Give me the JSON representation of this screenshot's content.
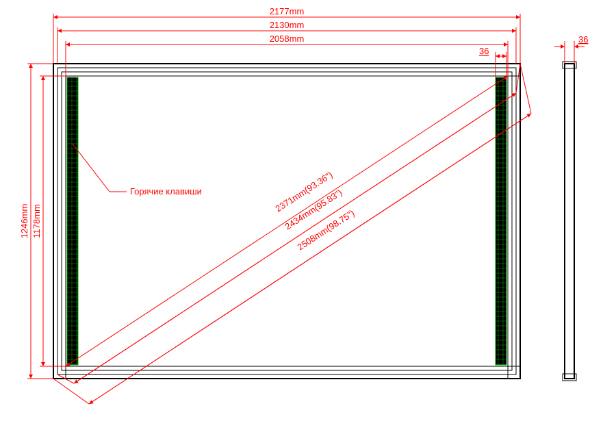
{
  "top_dims": {
    "d1": "2177mm",
    "d2": "2130mm",
    "d3": "2058mm",
    "small": "36"
  },
  "left_dims": {
    "d1": "1246mm",
    "d2": "1178mm"
  },
  "diag_dims": {
    "d1": "2371mm(93.36\")",
    "d2": "2434mm(95.83\")",
    "d3": "2508mm(98.75\")"
  },
  "callout": "Горячие клавиши",
  "side_dim": "36"
}
